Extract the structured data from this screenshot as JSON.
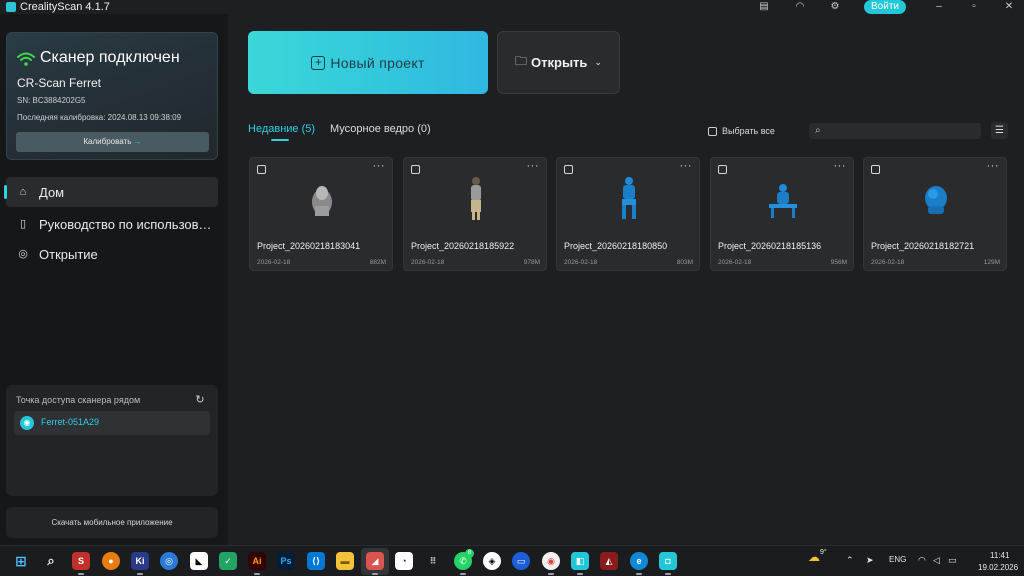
{
  "titlebar": {
    "app_title": "CrealityScan 4.1.7",
    "login_label": "Войти",
    "icons": [
      "document-icon",
      "headset-icon",
      "settings-icon",
      "minimize-icon",
      "maximize-icon",
      "close-icon"
    ]
  },
  "sidebar": {
    "connection": {
      "title": "Сканер подключен",
      "model": "CR-Scan Ferret",
      "sn": "SN: BC3884202G5",
      "calibration": "Последняя калибровка: 2024.08.13 09:38:09",
      "calibrate_label": "Калибровать",
      "calibrate_arrow": "→",
      "status_color": "#3fd84a"
    },
    "nav": [
      {
        "label": "Дом",
        "icon": "home-icon",
        "active": true
      },
      {
        "label": "Руководство по использованию",
        "icon": "book-icon",
        "active": false
      },
      {
        "label": "Открытие",
        "icon": "compass-icon",
        "active": false
      }
    ],
    "hotspot": {
      "title": "Точка доступа сканера рядом",
      "device": "Ferret-051A29"
    },
    "mobile_label": "Скачать мобильное приложение"
  },
  "main": {
    "new_project_label": "Новый проект",
    "open_label": "Открыть",
    "tabs": [
      {
        "label": "Недавние (5)",
        "active": true
      },
      {
        "label": "Мусорное ведро (0)",
        "active": false
      }
    ],
    "select_all_label": "Выбрать все",
    "search_placeholder": "",
    "accent_color": "#2fd0e0",
    "projects": [
      {
        "name": "Project_20260218183041",
        "date": "2026-02-18",
        "size": "882M",
        "thumb": "gray-bust"
      },
      {
        "name": "Project_20260218185922",
        "date": "2026-02-18",
        "size": "978M",
        "thumb": "standing-person"
      },
      {
        "name": "Project_20260218180850",
        "date": "2026-02-18",
        "size": "803M",
        "thumb": "blue-seated"
      },
      {
        "name": "Project_20260218185136",
        "date": "2026-02-18",
        "size": "956M",
        "thumb": "blue-bench"
      },
      {
        "name": "Project_20260218182721",
        "date": "2026-02-18",
        "size": "129M",
        "thumb": "blue-head"
      }
    ]
  },
  "taskbar": {
    "weather": "9°",
    "language": "ENG",
    "time": "11:41",
    "date": "19.02.2026",
    "whatsapp_badge": "8"
  }
}
